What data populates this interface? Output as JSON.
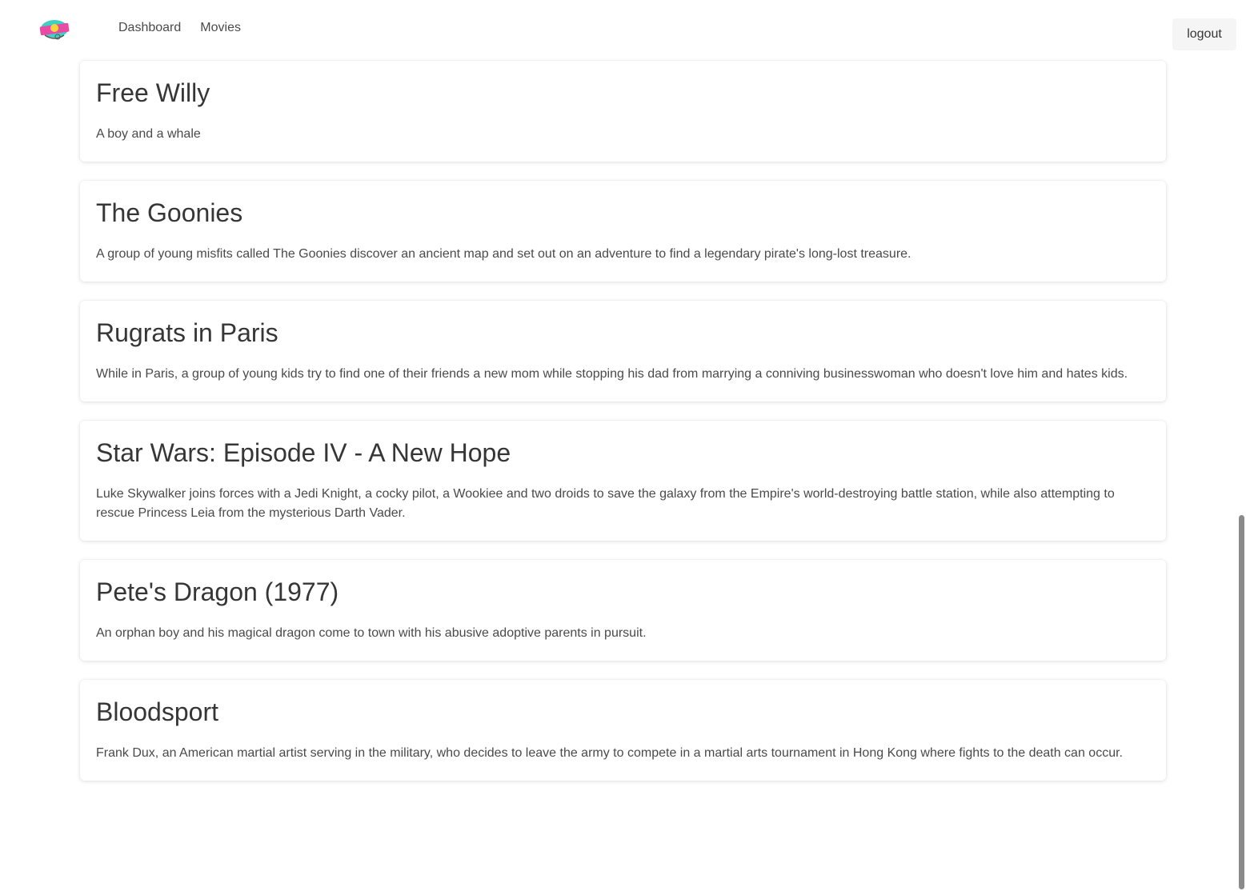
{
  "nav": {
    "links": [
      {
        "label": "Dashboard"
      },
      {
        "label": "Movies"
      }
    ],
    "logout_label": "logout"
  },
  "icons": {
    "logo": "app-logo",
    "brand_colors": [
      "#e94aa6",
      "#3fd0c4",
      "#f5d63a"
    ]
  },
  "movies": [
    {
      "title": "Free Willy",
      "description": "A boy and a whale"
    },
    {
      "title": "The Goonies",
      "description": "A group of young misfits called The Goonies discover an ancient map and set out on an adventure to find a legendary pirate's long-lost treasure."
    },
    {
      "title": "Rugrats in Paris",
      "description": "While in Paris, a group of young kids try to find one of their friends a new mom while stopping his dad from marrying a conniving businesswoman who doesn't love him and hates kids."
    },
    {
      "title": "Star Wars: Episode IV - A New Hope",
      "description": "Luke Skywalker joins forces with a Jedi Knight, a cocky pilot, a Wookiee and two droids to save the galaxy from the Empire's world-destroying battle station, while also attempting to rescue Princess Leia from the mysterious Darth Vader."
    },
    {
      "title": "Pete's Dragon (1977)",
      "description": "An orphan boy and his magical dragon come to town with his abusive adoptive parents in pursuit."
    },
    {
      "title": "Bloodsport",
      "description": "Frank Dux, an American martial artist serving in the military, who decides to leave the army to compete in a martial arts tournament in Hong Kong where fights to the death can occur."
    }
  ]
}
